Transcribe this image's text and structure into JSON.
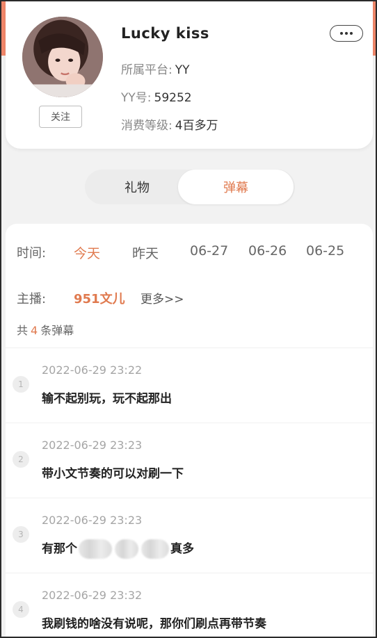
{
  "profile": {
    "nickname": "Lucky kiss",
    "platform_label": "所属平台:",
    "platform_value": "YY",
    "yy_label": "YY号:",
    "yy_value": "59252",
    "level_label": "消费等级:",
    "level_value": "4百多万",
    "follow_label": "关注",
    "more_icon": "ellipsis-icon"
  },
  "tabs": [
    {
      "label": "礼物",
      "active": false
    },
    {
      "label": "弹幕",
      "active": true
    }
  ],
  "filters": {
    "time_label": "时间:",
    "dates": [
      {
        "label": "今天",
        "active": true
      },
      {
        "label": "昨天",
        "active": false
      },
      {
        "label": "06-27",
        "active": false
      },
      {
        "label": "06-26",
        "active": false
      },
      {
        "label": "06-25",
        "active": false
      }
    ],
    "host_label": "主播:",
    "host_name": "951文儿",
    "host_more": "更多>>"
  },
  "summary": {
    "prefix": "共",
    "count": "4",
    "suffix": "条弹幕"
  },
  "messages": [
    {
      "index": "1",
      "time": "2022-06-29 23:22",
      "text": "输不起别玩，玩不起那出"
    },
    {
      "index": "2",
      "time": "2022-06-29 23:23",
      "text": "带小文节奏的可以对刷一下"
    },
    {
      "index": "3",
      "time": "2022-06-29 23:23",
      "text_before": "有那个",
      "text_after": "真多"
    },
    {
      "index": "4",
      "time": "2022-06-29 23:32",
      "text": "我刷钱的啥没有说呢，那你们刷点再带节奏"
    }
  ],
  "colors": {
    "accent": "#e07a4f",
    "strip": "#f0876a",
    "background": "#f2f2f2"
  }
}
